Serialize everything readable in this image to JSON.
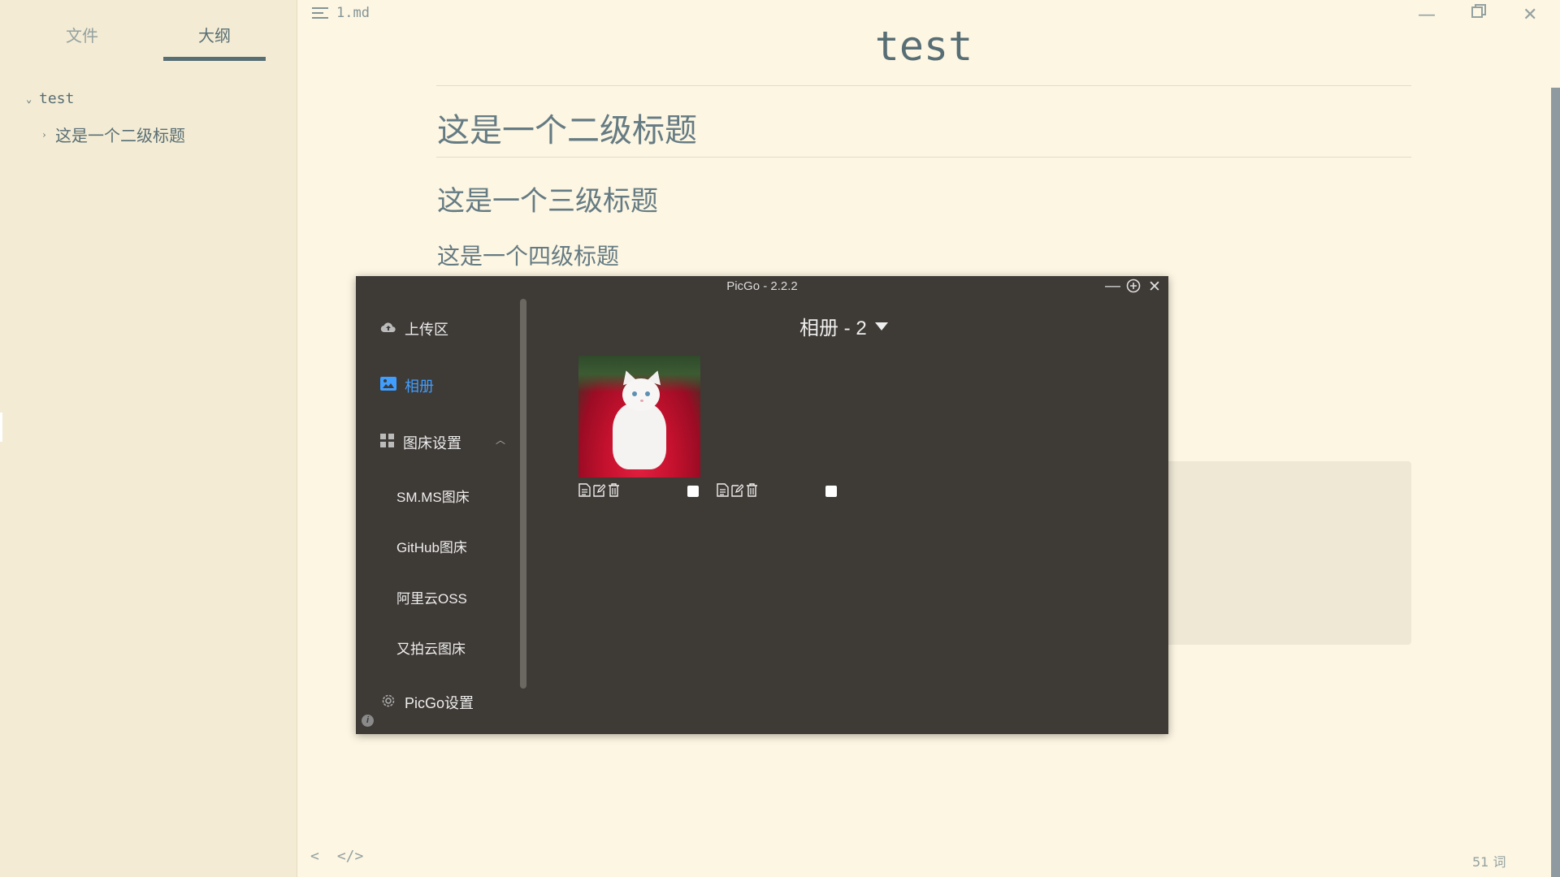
{
  "sidebar": {
    "tabs": {
      "files": "文件",
      "outline": "大纲"
    },
    "outline": [
      {
        "label": "test",
        "expanded": true
      },
      {
        "label": "这是一个二级标题",
        "expanded": false
      }
    ]
  },
  "editor": {
    "filename": "1.md",
    "title": "test",
    "headings": {
      "h2": "这是一个二级标题",
      "h3": "这是一个三级标题",
      "h4": "这是一个四级标题"
    },
    "word_count": "51 词",
    "footer_icons": [
      "chevron-left-icon",
      "source-code-icon"
    ]
  },
  "window_controls": [
    "minimize-icon",
    "restore-icon",
    "close-icon"
  ],
  "picgo": {
    "title": "PicGo - 2.2.2",
    "menu": {
      "upload": "上传区",
      "album": "相册",
      "picbed_settings": "图床设置",
      "picbeds": [
        "SM.MS图床",
        "GitHub图床",
        "阿里云OSS",
        "又拍云图床"
      ],
      "picgo_settings": "PicGo设置"
    },
    "active_menu": "album",
    "album_title": "相册 - 2",
    "album_items": [
      {
        "has_thumbnail": true,
        "checked": false
      },
      {
        "has_thumbnail": false,
        "checked": false
      }
    ],
    "accent": "#409eff"
  }
}
